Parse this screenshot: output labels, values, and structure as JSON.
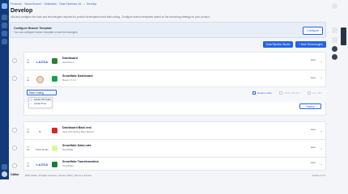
{
  "breadcrumb": [
    "Products",
    "Saura Bucket",
    "Dinkhitest",
    "Data Pipelines-16...",
    "Develop"
  ],
  "page": {
    "title": "Develop",
    "subtitle": "Add and configure the tools and technologies required for product development and start coding. Configure branch templates based on the branching strategy for your product."
  },
  "branch_template": {
    "title": "Configure Branch Template",
    "subtitle": "You can configure branch template on add technologies",
    "button": "Configure"
  },
  "actions": {
    "pipeline_studio": "Data Pipeline Studio",
    "new_technologies": "+ New Technologies"
  },
  "cards": [
    {
      "logo": "LAZSA",
      "name": "Dashboard",
      "sub": "dell-dinkut",
      "stack_color": "#2e7d32",
      "icon_color": "#ffffff"
    },
    {
      "name": "Snowflake Dashboard",
      "sub": "React 17.0.2",
      "stack_color": "#16a34a",
      "icon_color": "#ffffff"
    },
    {
      "name": "Dashboard Back end",
      "sub": "Java with Spring Boot Maven",
      "stack_color": "#dc2626",
      "icon_color": "#ffffff"
    },
    {
      "logo": "Data Studio",
      "name": "Snowflake Data Lake",
      "sub": "Snowflake",
      "stack_color": "#d9f99d",
      "icon_color": "#ffffff"
    },
    {
      "logo": "LAZSA",
      "name": "Snowflake Transformation",
      "sub": "Snowflake",
      "stack_color": "#15803d",
      "icon_color": "#ffffff"
    }
  ],
  "expanded": {
    "select_value": "Start Coding",
    "options": [
      "Lazsa VS Code",
      "Lazsa Time"
    ],
    "tabs": [
      "Source Code",
      "CI/CD Pipeline",
      "Live URL"
    ],
    "fragment": "ment.",
    "deploy": "Deploy"
  },
  "footer": {
    "brand": "Calibo",
    "links": "2023 Calibo. All rights reserved.  |  Privacy Policy  |  Terms of Service",
    "version": "Version 3.1.3"
  },
  "colors": {
    "accent": "#2563eb",
    "sidebar": "#123a78",
    "drawer": "#243447"
  }
}
